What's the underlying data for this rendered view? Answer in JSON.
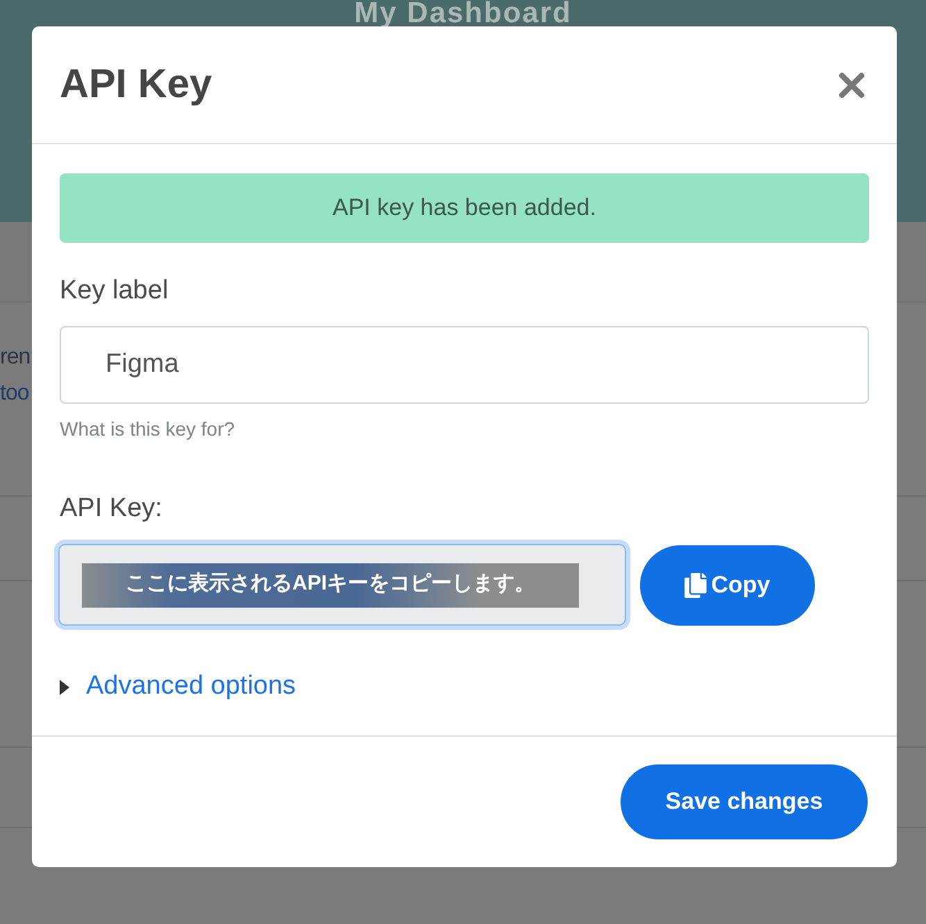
{
  "page": {
    "heading": "My Dashboard",
    "fragments": [
      {
        "text": "ren",
        "kind": "text"
      },
      {
        "text": "too",
        "kind": "link"
      }
    ]
  },
  "modal": {
    "title": "API Key",
    "alert": {
      "kind": "success",
      "text": "API key has been added."
    },
    "key_label": {
      "label": "Key label",
      "value": "Figma",
      "hint": "What is this key for?"
    },
    "api_key": {
      "label": "API Key:",
      "notice": "ここに表示されるAPIキーをコピーします。",
      "focused": true,
      "copy_button": "Copy"
    },
    "advanced": {
      "label": "Advanced options",
      "expanded": false
    },
    "footer": {
      "save_button": "Save changes"
    }
  }
}
